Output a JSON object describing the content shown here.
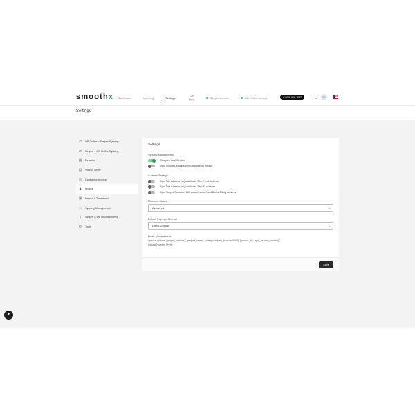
{
  "header": {
    "logo_main": "smooth",
    "logo_accent": "x",
    "nav": [
      {
        "label": "Dashboard"
      },
      {
        "label": "Mapping"
      },
      {
        "label": "Settings"
      },
      {
        "label": "Get\nHelp"
      }
    ],
    "status": [
      {
        "label": "Simpro Access"
      },
      {
        "label": "QB Online Access"
      }
    ],
    "phone": "+1 628-600-3582",
    "avatar_initials": "SG",
    "accent_color": "#2e9e4e"
  },
  "page": {
    "title": "Settings"
  },
  "sidebar": {
    "items": [
      {
        "label": "QB Online > Simpro Syncing",
        "icon": "sync-arrows-icon"
      },
      {
        "label": "Simpro > QB Online Syncing",
        "icon": "sync-arrows-icon"
      },
      {
        "label": "Defaults",
        "icon": "grid-icon"
      },
      {
        "label": "Vendor Order",
        "icon": "document-icon"
      },
      {
        "label": "Contractor Invoice",
        "icon": "contractor-icon"
      },
      {
        "label": "Invoice",
        "icon": "dollar-icon"
      },
      {
        "label": "Payroll & Timesheet",
        "icon": "payroll-icon"
      },
      {
        "label": "Syncing Management",
        "icon": "link-icon"
      },
      {
        "label": "Simpro & QB Online Access",
        "icon": "key-icon"
      },
      {
        "label": "Tools",
        "icon": "gear-icon"
      }
    ]
  },
  "card": {
    "title": "Settings",
    "syncing_management": {
      "label": "Syncing Management",
      "toggles": [
        {
          "label": "Group by Cost Centers",
          "on": true
        },
        {
          "label": "Sync Invoice Description to Message on invoice",
          "on": false
        }
      ]
    },
    "address_settings": {
      "label": "Address Settings",
      "toggles": [
        {
          "label": "Sync Site Address to QuickBooks Ship From Address",
          "on": false
        },
        {
          "label": "Sync Site Address to QuickBooks Ship To Address",
          "on": false
        },
        {
          "label": "Sync Simpro Customer Billing Address to QuickBooks Billing Address",
          "on": false
        }
      ]
    },
    "minimum_status": {
      "label": "Minimum Status",
      "value": "Approved"
    },
    "default_payment_method": {
      "label": "Default Payment Method",
      "value": "Direct Deposit"
    },
    "prefix_management": {
      "label": "Prefix Management",
      "special_options": "Special options: {project_number}, {project_name}, {claim_number}, {#cnum-0000}, {invoice_id}, {qbo_invoice_number}",
      "invoice_number_prefix": "Invoice Number Prefix"
    },
    "save_label": "Save"
  }
}
